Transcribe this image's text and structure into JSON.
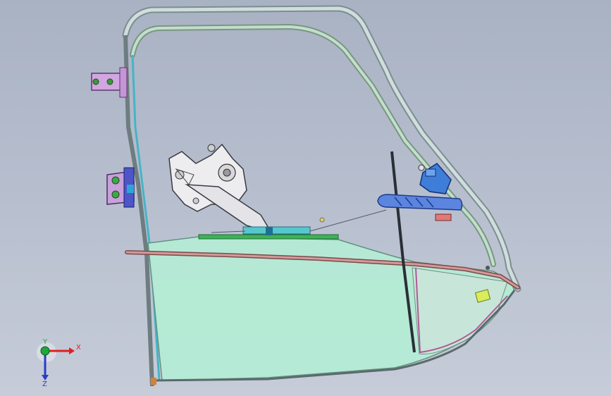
{
  "viewport": {
    "background_top": "#a9b2c3",
    "background_bottom": "#c6ccd8"
  },
  "triad": {
    "x_label": "X",
    "y_label": "Y",
    "z_label": "Z",
    "x_color": "#e02020",
    "y_color": "#1fa83a",
    "z_color": "#2a3cc8"
  },
  "parts": {
    "frame_outer": "#c9d7d7",
    "frame_inner": "#b9d9c8",
    "glass": "#b5ecd6",
    "glass_edge": "#d05a86",
    "window_regulator": "#e9e9ec",
    "outer_handle": "#3b6fd6",
    "hinge": "#c99ad8",
    "rail_strip": "#3fb15a",
    "belt_molding": "#c77b7b"
  }
}
